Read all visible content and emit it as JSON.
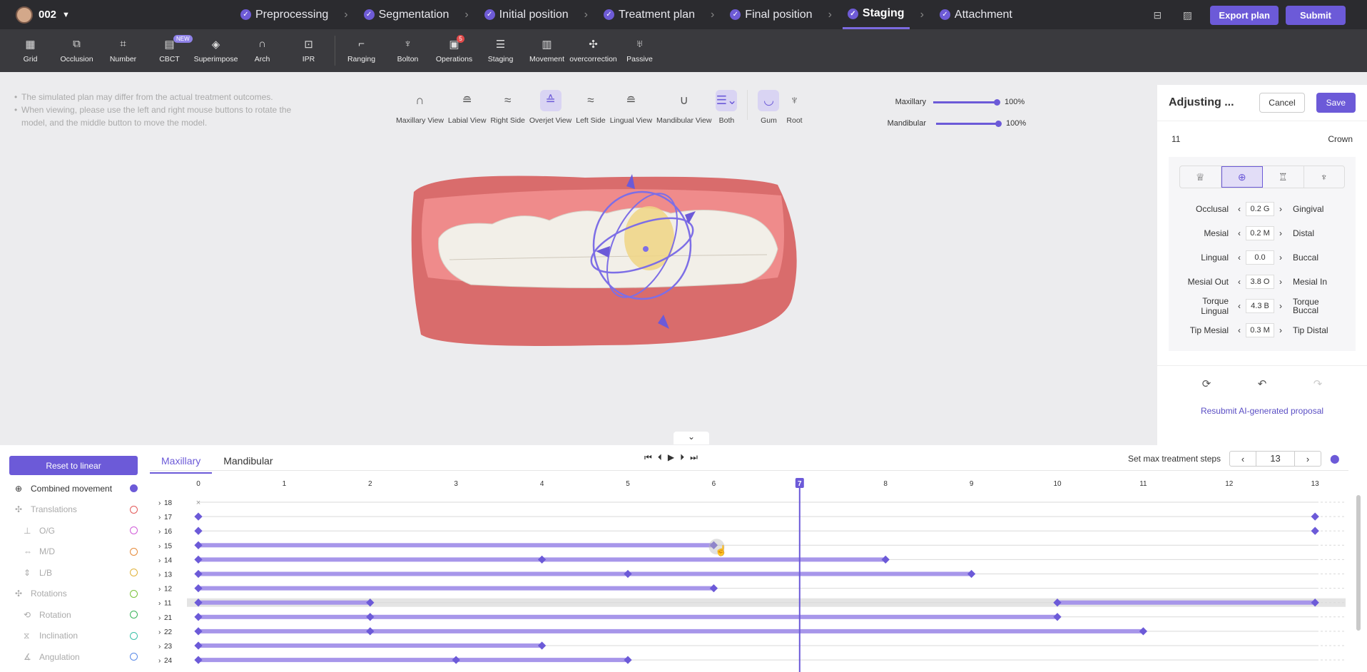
{
  "header": {
    "user": "002",
    "steps": [
      {
        "label": "Preprocessing",
        "active": false
      },
      {
        "label": "Segmentation",
        "active": false
      },
      {
        "label": "Initial position",
        "active": false
      },
      {
        "label": "Treatment plan",
        "active": false
      },
      {
        "label": "Final position",
        "active": false
      },
      {
        "label": "Staging",
        "active": true
      },
      {
        "label": "Attachment",
        "active": false
      }
    ],
    "export_label": "Export plan",
    "submit_label": "Submit"
  },
  "toolbar": {
    "tools": [
      {
        "label": "Grid",
        "icon": "grid-icon",
        "glyph": "▦"
      },
      {
        "label": "Occlusion",
        "icon": "occlusion-icon",
        "glyph": "⧉"
      },
      {
        "label": "Number",
        "icon": "number-icon",
        "glyph": "⌗"
      },
      {
        "label": "CBCT",
        "icon": "cbct-icon",
        "glyph": "▤",
        "badge": "NEW"
      },
      {
        "label": "Superimpose",
        "icon": "superimpose-icon",
        "glyph": "◈"
      },
      {
        "label": "Arch",
        "icon": "arch-icon",
        "glyph": "∩"
      },
      {
        "label": "IPR",
        "icon": "ipr-icon",
        "glyph": "⊡"
      },
      {
        "label": "Ranging",
        "icon": "ranging-icon",
        "glyph": "⌐",
        "divider_before": true
      },
      {
        "label": "Bolton",
        "icon": "bolton-icon",
        "glyph": "♆"
      },
      {
        "label": "Operations",
        "icon": "operations-icon",
        "glyph": "▣",
        "count": "5"
      },
      {
        "label": "Staging",
        "icon": "staging-icon",
        "glyph": "☰"
      },
      {
        "label": "Movement",
        "icon": "movement-icon",
        "glyph": "▥"
      },
      {
        "label": "overcorrection",
        "icon": "overcorrection-icon",
        "glyph": "✣"
      },
      {
        "label": "Passive",
        "icon": "passive-icon",
        "glyph": "♅"
      }
    ]
  },
  "viewport": {
    "notes": [
      "The simulated plan may differ from the actual treatment outcomes.",
      "When viewing, please use the left and right mouse buttons to rotate the model, and the middle button to move the model."
    ],
    "views": [
      {
        "label": "Maxillary View",
        "icon": "maxillary-view-icon",
        "glyph": "∩"
      },
      {
        "label": "Labial View",
        "icon": "labial-view-icon",
        "glyph": "≘"
      },
      {
        "label": "Right Side",
        "icon": "right-side-icon",
        "glyph": "≈"
      },
      {
        "label": "Overjet View",
        "icon": "overjet-view-icon",
        "glyph": "≙",
        "selected": true
      },
      {
        "label": "Left Side",
        "icon": "left-side-icon",
        "glyph": "≈"
      },
      {
        "label": "Lingual View",
        "icon": "lingual-view-icon",
        "glyph": "≘"
      },
      {
        "label": "Mandibular View",
        "icon": "mandibular-view-icon",
        "glyph": "∪"
      },
      {
        "label": "Both",
        "icon": "both-icon",
        "glyph": "☰⌄",
        "selected": true
      },
      {
        "label": "Gum",
        "icon": "gum-icon",
        "glyph": "◡",
        "selected": true
      },
      {
        "label": "Root",
        "icon": "root-icon",
        "glyph": "♆"
      }
    ],
    "maxillary_label": "Maxillary",
    "maxillary_value": "100%",
    "mandibular_label": "Mandibular",
    "mandibular_value": "100%"
  },
  "panel": {
    "title": "Adjusting ...",
    "cancel_label": "Cancel",
    "save_label": "Save",
    "tooth": "11",
    "mode": "Crown",
    "adjustments": [
      {
        "left": "Occlusal",
        "value": "0.2 G",
        "right": "Gingival"
      },
      {
        "left": "Mesial",
        "value": "0.2 M",
        "right": "Distal"
      },
      {
        "left": "Lingual",
        "value": "0.0",
        "right": "Buccal"
      },
      {
        "left": "Mesial Out",
        "value": "3.8 O",
        "right": "Mesial In"
      },
      {
        "left": "Torque Lingual",
        "value": "4.3 B",
        "right": "Torque Buccal"
      },
      {
        "left": "Tip Mesial",
        "value": "0.3 M",
        "right": "Tip Distal"
      }
    ],
    "resubmit_label": "Resubmit AI-generated proposal"
  },
  "staging": {
    "reset_label": "Reset to linear",
    "tabs": [
      {
        "label": "Maxillary",
        "selected": true
      },
      {
        "label": "Mandibular",
        "selected": false
      }
    ],
    "max_steps_label": "Set max treatment steps",
    "max_steps_value": "13",
    "movements": [
      {
        "label": "Combined movement",
        "color": "#6c5ad8",
        "filled": true,
        "level": 0
      },
      {
        "label": "Translations",
        "color": "#e35a5a",
        "level": 0
      },
      {
        "label": "O/G",
        "color": "#d05ad8",
        "level": 1
      },
      {
        "label": "M/D",
        "color": "#e58a3a",
        "level": 1
      },
      {
        "label": "L/B",
        "color": "#e0b23a",
        "level": 1
      },
      {
        "label": "Rotations",
        "color": "#7ac23a",
        "level": 0
      },
      {
        "label": "Rotation",
        "color": "#3ab45a",
        "level": 1
      },
      {
        "label": "Inclination",
        "color": "#3ac0a8",
        "level": 1
      },
      {
        "label": "Angulation",
        "color": "#5a8ae8",
        "level": 1
      }
    ],
    "step_labels": [
      "0",
      "1",
      "2",
      "3",
      "4",
      "5",
      "6",
      "7",
      "8",
      "9",
      "10",
      "11",
      "12",
      "13"
    ],
    "current_step": 7,
    "rows": [
      {
        "tooth": "18",
        "none": true,
        "segments": [],
        "points": []
      },
      {
        "tooth": "17",
        "segments": [],
        "points": [
          0,
          13
        ]
      },
      {
        "tooth": "16",
        "segments": [],
        "points": [
          0,
          13
        ]
      },
      {
        "tooth": "15",
        "segments": [
          [
            0,
            6
          ]
        ],
        "points": [
          0,
          6
        ]
      },
      {
        "tooth": "14",
        "segments": [
          [
            0,
            8
          ]
        ],
        "points": [
          0,
          4,
          8
        ]
      },
      {
        "tooth": "13",
        "segments": [
          [
            0,
            9
          ]
        ],
        "points": [
          0,
          5,
          9
        ]
      },
      {
        "tooth": "12",
        "segments": [
          [
            0,
            6
          ]
        ],
        "points": [
          0,
          6
        ]
      },
      {
        "tooth": "11",
        "selected": true,
        "segments": [
          [
            0,
            2
          ],
          [
            10,
            13
          ]
        ],
        "points": [
          0,
          2,
          10,
          13
        ]
      },
      {
        "tooth": "21",
        "segments": [
          [
            0,
            10
          ]
        ],
        "points": [
          0,
          2,
          10
        ]
      },
      {
        "tooth": "22",
        "segments": [
          [
            0,
            11
          ]
        ],
        "points": [
          0,
          2,
          11
        ]
      },
      {
        "tooth": "23",
        "segments": [
          [
            0,
            4
          ]
        ],
        "points": [
          0,
          4
        ]
      },
      {
        "tooth": "24",
        "segments": [
          [
            0,
            5
          ]
        ],
        "points": [
          0,
          3,
          5
        ]
      }
    ]
  }
}
